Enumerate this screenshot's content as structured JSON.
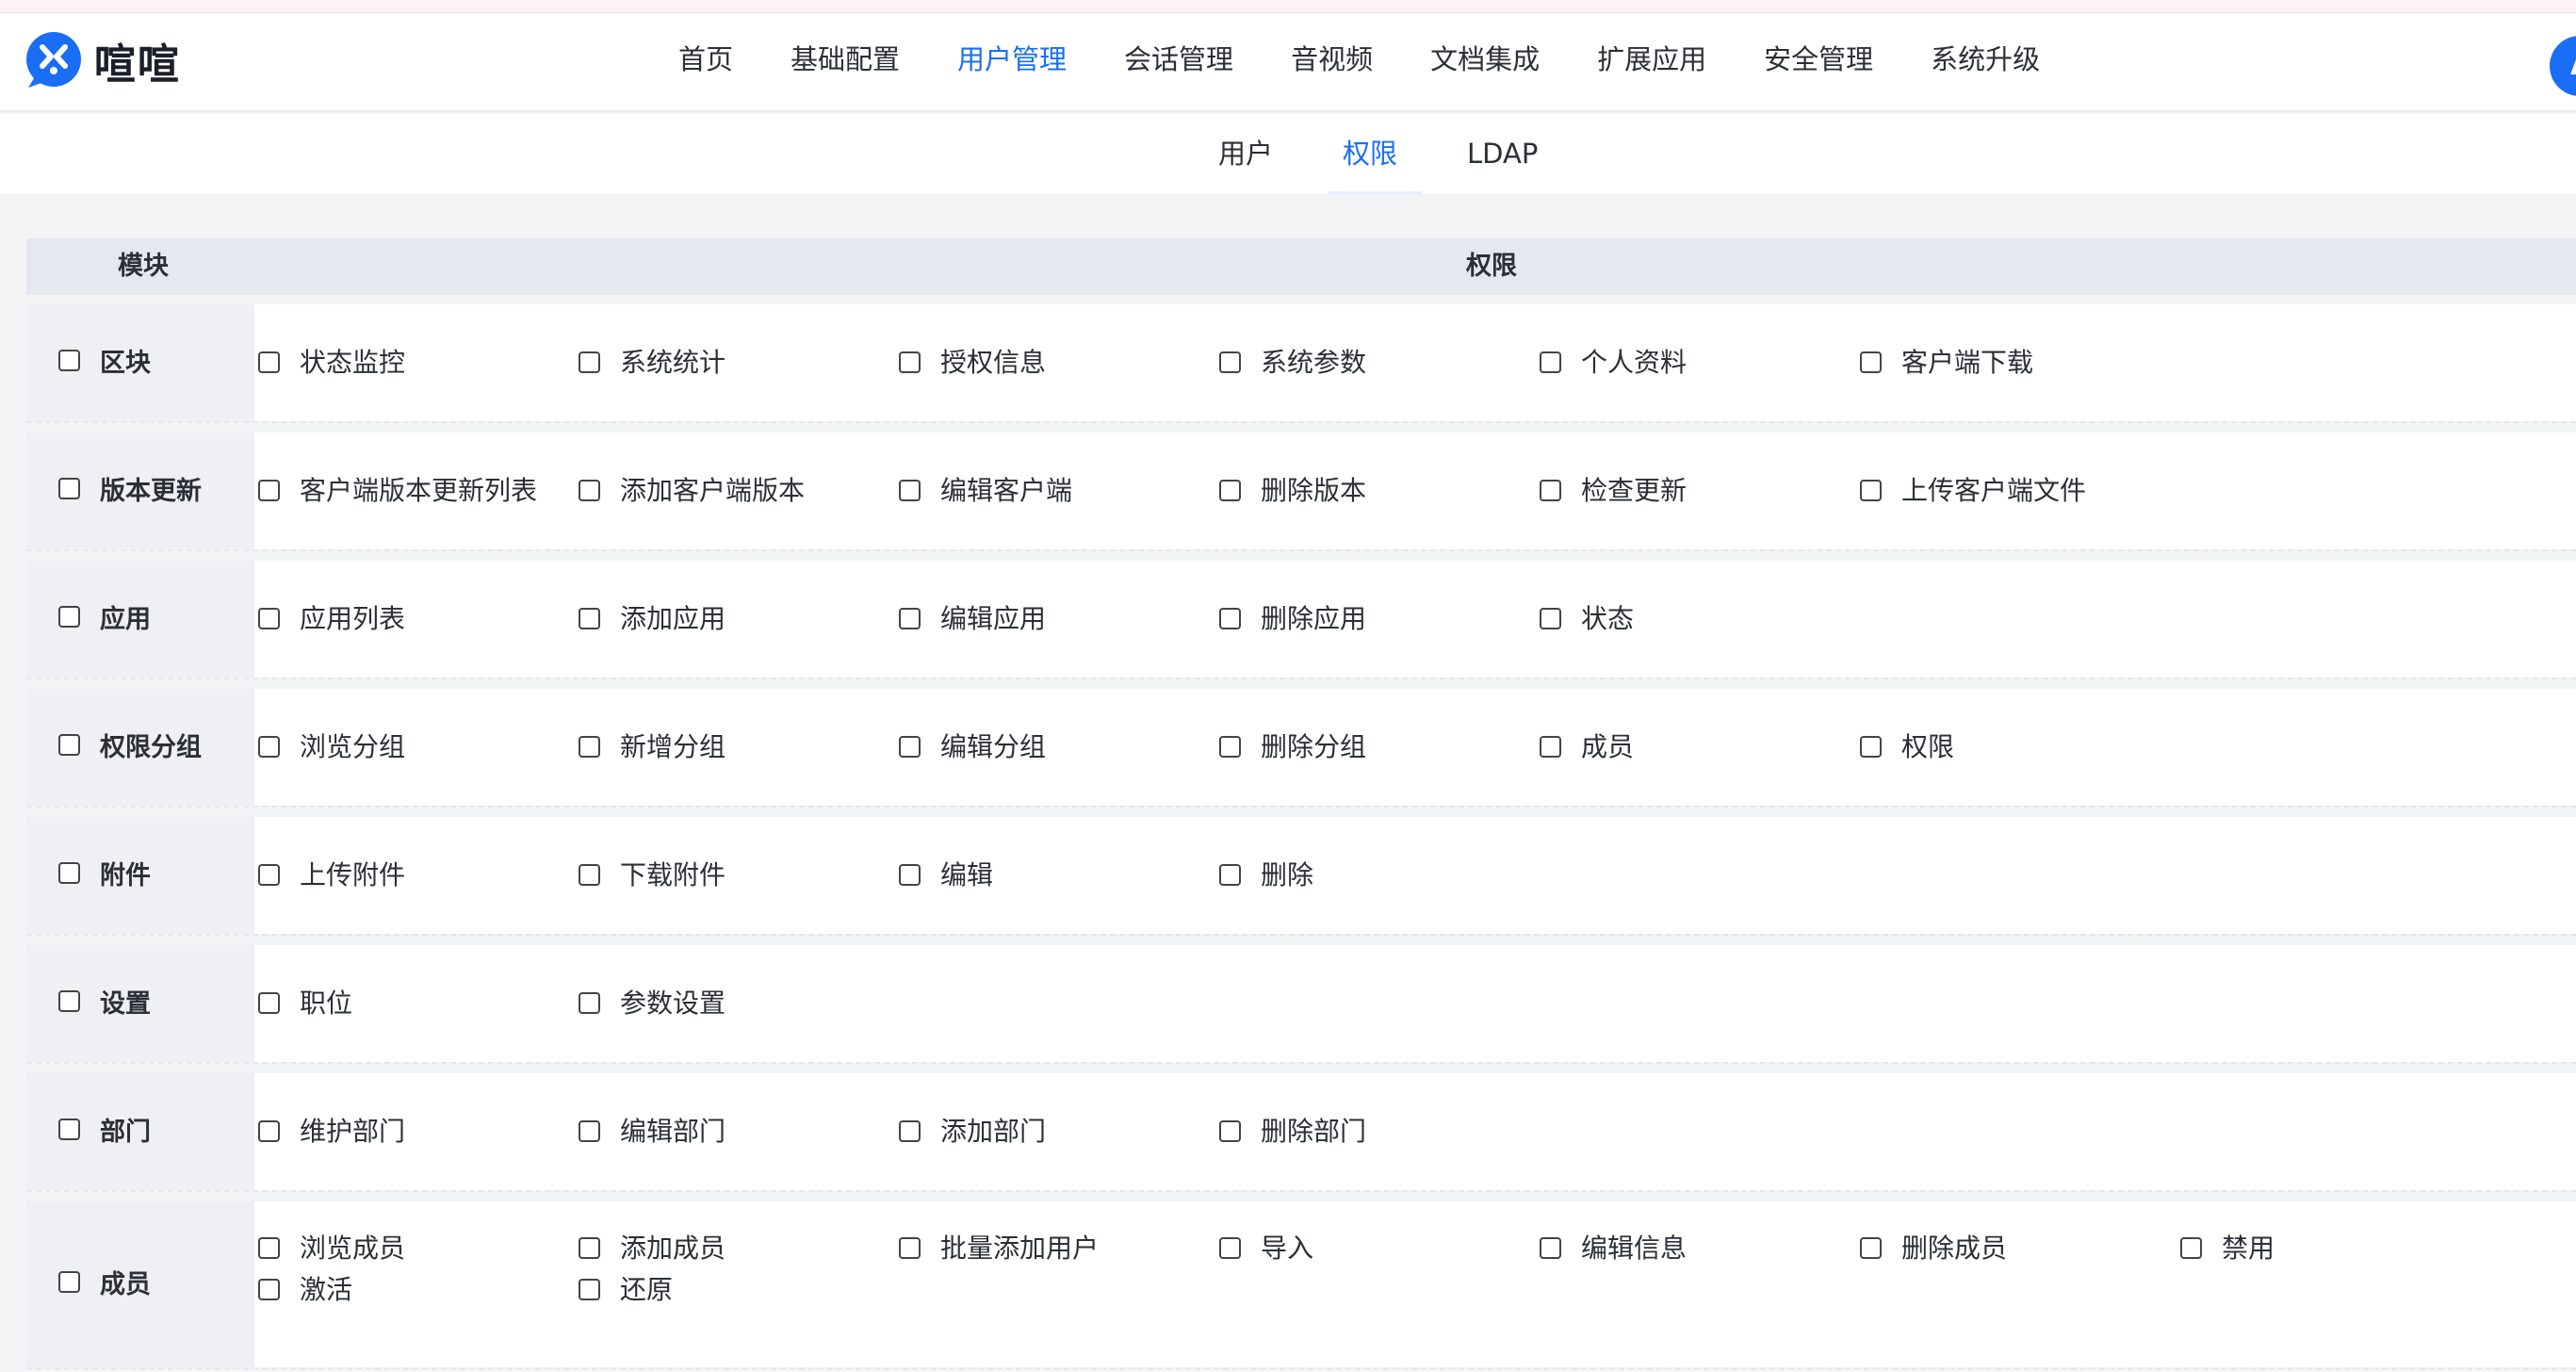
{
  "app": {
    "name": "喧喧",
    "avatar_initial": "A"
  },
  "nav": {
    "items": [
      "首页",
      "基础配置",
      "用户管理",
      "会话管理",
      "音视频",
      "文档集成",
      "扩展应用",
      "安全管理",
      "系统升级"
    ],
    "active_index": 2
  },
  "subnav": {
    "tabs": [
      "用户",
      "权限",
      "LDAP"
    ],
    "active_index": 1
  },
  "table": {
    "headers": {
      "module": "模块",
      "permissions": "权限"
    },
    "rows": [
      {
        "module": "区块",
        "checked": false,
        "permissions": [
          "状态监控",
          "系统统计",
          "授权信息",
          "系统参数",
          "个人资料",
          "客户端下载"
        ]
      },
      {
        "module": "版本更新",
        "checked": false,
        "permissions": [
          "客户端版本更新列表",
          "添加客户端版本",
          "编辑客户端",
          "删除版本",
          "检查更新",
          "上传客户端文件"
        ]
      },
      {
        "module": "应用",
        "checked": false,
        "permissions": [
          "应用列表",
          "添加应用",
          "编辑应用",
          "删除应用",
          "状态"
        ]
      },
      {
        "module": "权限分组",
        "checked": false,
        "permissions": [
          "浏览分组",
          "新增分组",
          "编辑分组",
          "删除分组",
          "成员",
          "权限"
        ]
      },
      {
        "module": "附件",
        "checked": false,
        "permissions": [
          "上传附件",
          "下载附件",
          "编辑",
          "删除"
        ]
      },
      {
        "module": "设置",
        "checked": false,
        "permissions": [
          "职位",
          "参数设置"
        ]
      },
      {
        "module": "部门",
        "checked": false,
        "permissions": [
          "维护部门",
          "编辑部门",
          "添加部门",
          "删除部门"
        ]
      },
      {
        "module": "成员",
        "checked": false,
        "permissions": [
          "浏览成员",
          "添加成员",
          "批量添加用户",
          "导入",
          "编辑信息",
          "删除成员",
          "禁用",
          "激活",
          "还原"
        ]
      }
    ]
  },
  "colors": {
    "accent": "#1a6ef5",
    "header_bg": "#e5e8ee",
    "module_bg": "#eef0f3"
  }
}
